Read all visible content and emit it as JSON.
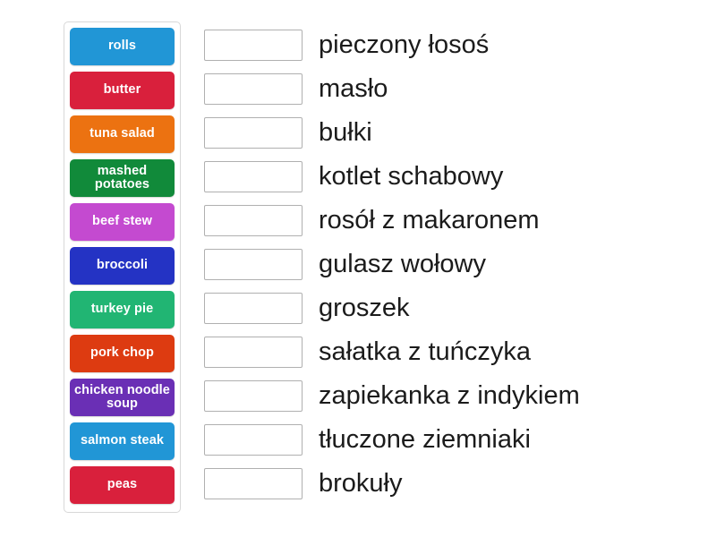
{
  "activity": {
    "type": "match-up",
    "tiles_panel": {
      "name": "draggable-answers-panel",
      "tiles": [
        {
          "label": "rolls",
          "color": "#2196d6"
        },
        {
          "label": "butter",
          "color": "#d9203c"
        },
        {
          "label": "tuna salad",
          "color": "#ec7211"
        },
        {
          "label": "mashed potatoes",
          "color": "#118a3a"
        },
        {
          "label": "beef stew",
          "color": "#c44ad0"
        },
        {
          "label": "broccoli",
          "color": "#2433c4"
        },
        {
          "label": "turkey pie",
          "color": "#21b573"
        },
        {
          "label": "pork chop",
          "color": "#dd3b11"
        },
        {
          "label": "chicken noodle soup",
          "color": "#6a2fb5"
        },
        {
          "label": "salmon steak",
          "color": "#2196d6"
        },
        {
          "label": "peas",
          "color": "#d9203c"
        }
      ]
    },
    "rows": [
      {
        "answer": "",
        "prompt": "pieczony łosoś"
      },
      {
        "answer": "",
        "prompt": "masło"
      },
      {
        "answer": "",
        "prompt": "bułki"
      },
      {
        "answer": "",
        "prompt": "kotlet schabowy"
      },
      {
        "answer": "",
        "prompt": "rosół z makaronem"
      },
      {
        "answer": "",
        "prompt": "gulasz wołowy"
      },
      {
        "answer": "",
        "prompt": "groszek"
      },
      {
        "answer": "",
        "prompt": "sałatka z tuńczyka"
      },
      {
        "answer": "",
        "prompt": "zapiekanka z indykiem"
      },
      {
        "answer": "",
        "prompt": "tłuczone ziemniaki"
      },
      {
        "answer": "",
        "prompt": "brokuły"
      }
    ],
    "colors": {
      "background": "#ffffff",
      "panel_border": "#d8d8d8",
      "dropbox_border": "#b0b0b0",
      "prompt_text": "#1b1b1b",
      "tile_text": "#ffffff"
    }
  }
}
